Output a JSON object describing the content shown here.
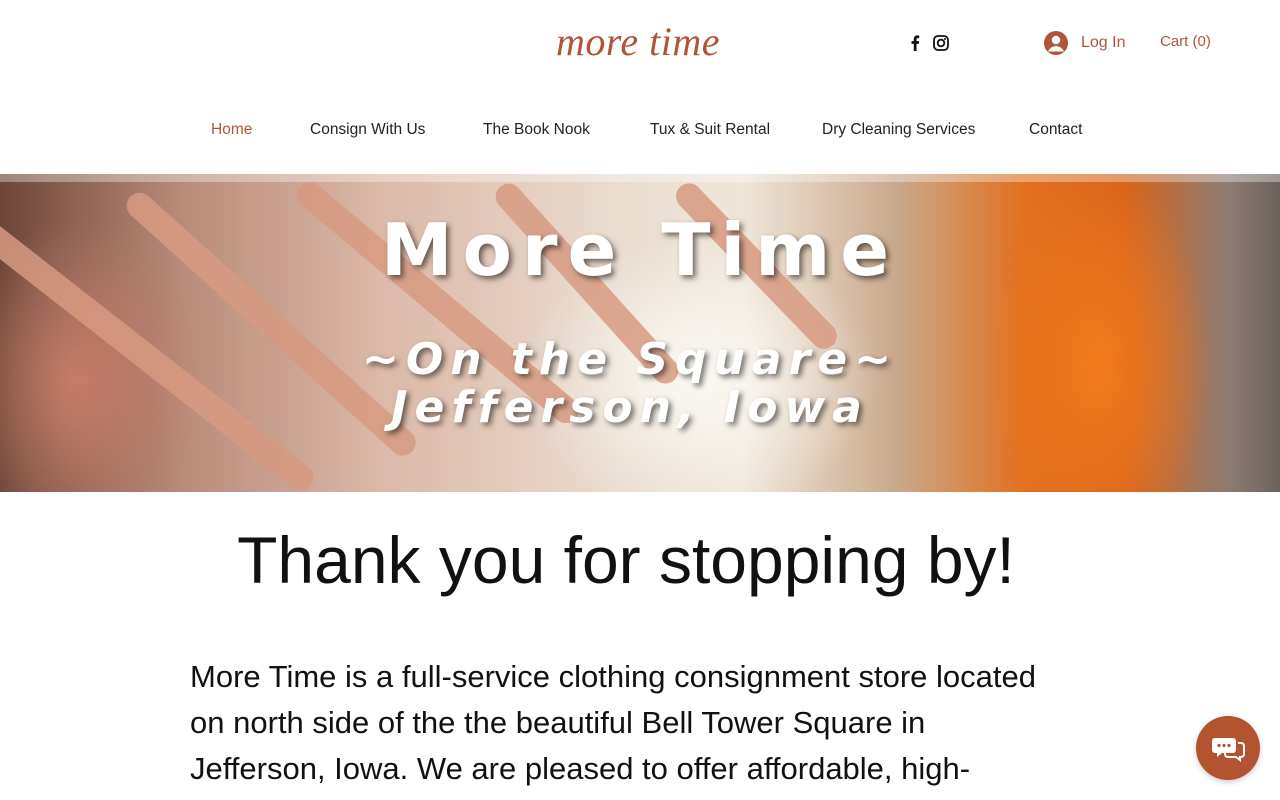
{
  "header": {
    "logo_text": "more time",
    "social": [
      {
        "icon": "facebook-icon"
      },
      {
        "icon": "instagram-icon"
      }
    ],
    "login_label": "Log In",
    "cart_label": "Cart (0)"
  },
  "nav": {
    "items": [
      {
        "label": "Home",
        "active": true
      },
      {
        "label": "Consign With Us",
        "active": false
      },
      {
        "label": "The Book Nook",
        "active": false
      },
      {
        "label": "Tux & Suit Rental",
        "active": false
      },
      {
        "label": "Dry Cleaning Services",
        "active": false
      },
      {
        "label": "Contact",
        "active": false
      }
    ]
  },
  "hero": {
    "title": "More Time",
    "subtitle_line1": "~On the Square~",
    "subtitle_line2": "Jefferson, Iowa"
  },
  "content": {
    "heading": "Thank you for stopping by!",
    "body": "More Time is a full-service clothing consignment store located on north side of the the beautiful Bell Tower Square in Jefferson, Iowa.  We are pleased to offer affordable, high-"
  },
  "colors": {
    "accent": "#b1553a",
    "chat_button": "#b4532f"
  },
  "chat": {
    "icon": "chat-bubbles-icon"
  }
}
